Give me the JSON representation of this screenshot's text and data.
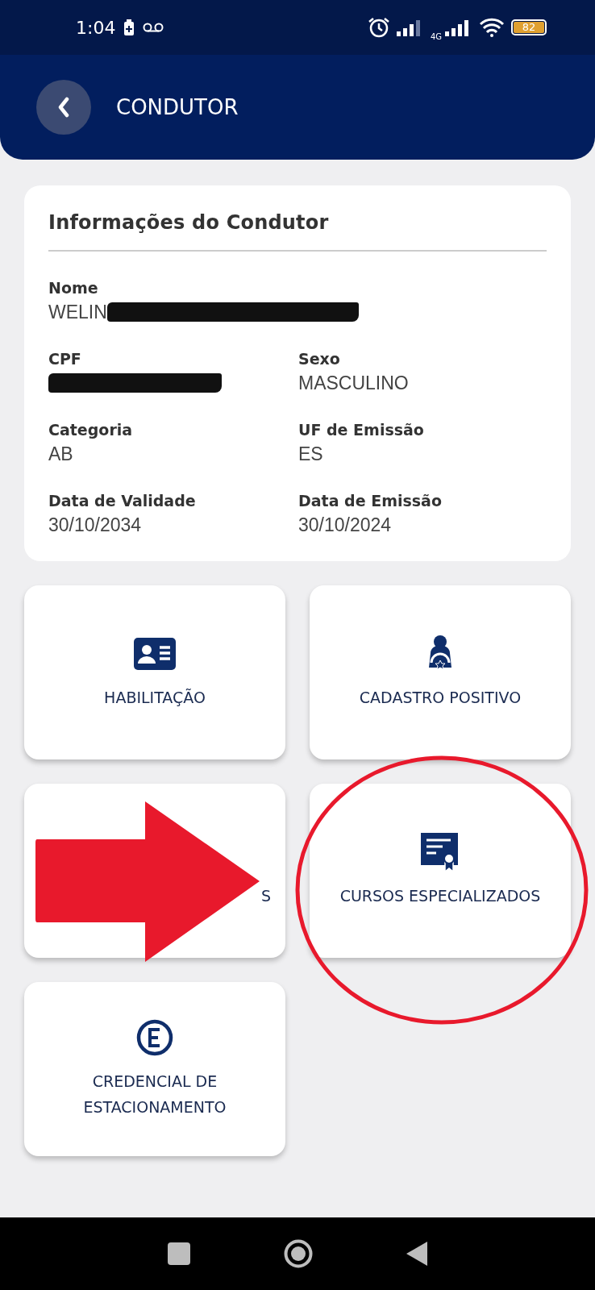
{
  "status_bar": {
    "time": "1:04",
    "network": "4G",
    "battery": "82"
  },
  "header": {
    "title": "CONDUTOR"
  },
  "info_card": {
    "title": "Informações do Condutor",
    "holder": {
      "label": "Nome",
      "value": "WELIN",
      "redacted": true
    },
    "fields": [
      {
        "label": "CPF",
        "redacted": true
      },
      {
        "label": "Sexo",
        "value": "MASCULINO"
      },
      {
        "label": "Categoria",
        "value": "AB"
      },
      {
        "label": "UF de Emissão",
        "value": "ES"
      },
      {
        "label": "Data de Validade",
        "value": "30/10/2034"
      },
      {
        "label": "Data de Emissão",
        "value": "30/10/2024"
      }
    ]
  },
  "tiles": [
    {
      "label": "HABILITAÇÃO",
      "kind": "license"
    },
    {
      "label": "CADASTRO POSITIVO",
      "kind": "driver"
    },
    {
      "label": "S",
      "kind": "obscured"
    },
    {
      "label": "CURSOS ESPECIALIZADOS",
      "kind": "certificate"
    },
    {
      "label": "CREDENCIAL DE ESTACIONAMENTO",
      "kind": "parking"
    }
  ],
  "annotations": {
    "arrow": {
      "color": "#e8192c"
    },
    "circle": {
      "color": "#e8192c"
    }
  }
}
